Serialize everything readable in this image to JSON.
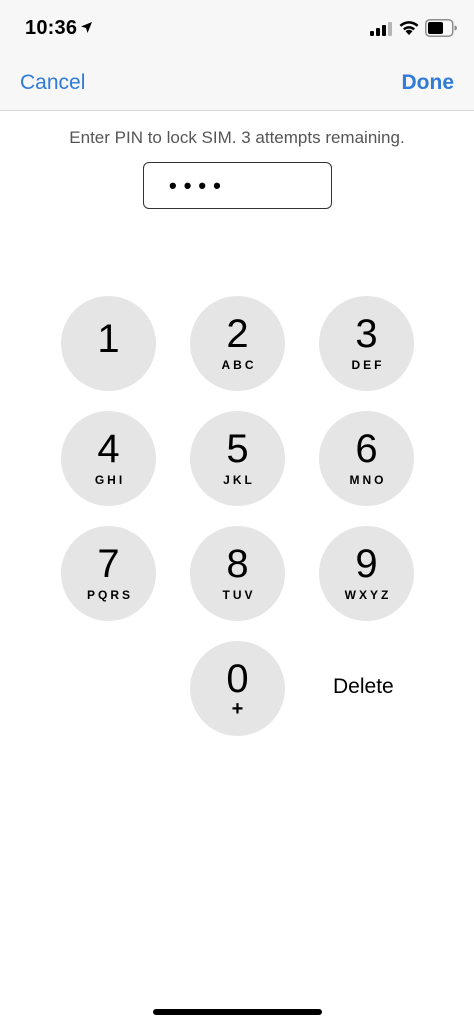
{
  "status_bar": {
    "time": "10:36",
    "icons": [
      "location-arrow-icon",
      "cellular-signal-icon",
      "wifi-icon",
      "battery-icon"
    ]
  },
  "nav": {
    "cancel_label": "Cancel",
    "done_label": "Done",
    "accent_color": "#2f7bd6"
  },
  "prompt": "Enter PIN to lock SIM. 3 attempts remaining.",
  "pin_display": "••••",
  "keypad": {
    "keys": [
      {
        "digit": "1",
        "letters": ""
      },
      {
        "digit": "2",
        "letters": "ABC"
      },
      {
        "digit": "3",
        "letters": "DEF"
      },
      {
        "digit": "4",
        "letters": "GHI"
      },
      {
        "digit": "5",
        "letters": "JKL"
      },
      {
        "digit": "6",
        "letters": "MNO"
      },
      {
        "digit": "7",
        "letters": "PQRS"
      },
      {
        "digit": "8",
        "letters": "TUV"
      },
      {
        "digit": "9",
        "letters": "WXYZ"
      },
      {
        "digit": "0",
        "letters": "+"
      }
    ],
    "delete_label": "Delete",
    "key_color": "#e5e5e5"
  }
}
